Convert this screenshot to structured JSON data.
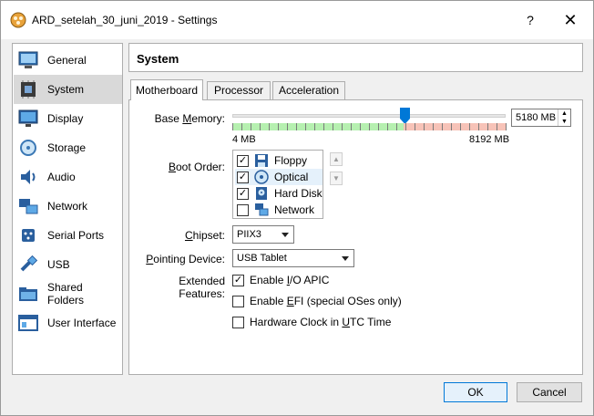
{
  "window": {
    "title": "ARD_setelah_30_juni_2019 - Settings",
    "help": "?",
    "close": "✕"
  },
  "sidebar": {
    "items": [
      {
        "label": "General",
        "icon": "general-icon"
      },
      {
        "label": "System",
        "icon": "system-icon",
        "active": true
      },
      {
        "label": "Display",
        "icon": "display-icon"
      },
      {
        "label": "Storage",
        "icon": "storage-icon"
      },
      {
        "label": "Audio",
        "icon": "audio-icon"
      },
      {
        "label": "Network",
        "icon": "network-icon"
      },
      {
        "label": "Serial Ports",
        "icon": "serial-ports-icon"
      },
      {
        "label": "USB",
        "icon": "usb-icon"
      },
      {
        "label": "Shared Folders",
        "icon": "shared-folders-icon"
      },
      {
        "label": "User Interface",
        "icon": "user-interface-icon"
      }
    ]
  },
  "page": {
    "title": "System"
  },
  "tabs": [
    {
      "label": "Motherboard",
      "active": true
    },
    {
      "label": "Processor"
    },
    {
      "label": "Acceleration"
    }
  ],
  "motherboard": {
    "base_memory": {
      "label_pre": "Base ",
      "label_u": "M",
      "label_post": "emory:",
      "min": "4 MB",
      "max": "8192 MB",
      "value": "5180 MB",
      "fraction": 0.632
    },
    "boot_order": {
      "label_pre": "",
      "label_u": "B",
      "label_post": "oot Order:",
      "items": [
        {
          "label": "Floppy",
          "checked": true,
          "icon": "floppy-icon"
        },
        {
          "label": "Optical",
          "checked": true,
          "icon": "optical-icon",
          "selected": true
        },
        {
          "label": "Hard Disk",
          "checked": true,
          "icon": "hard-disk-icon"
        },
        {
          "label": "Network",
          "checked": false,
          "icon": "network-icon"
        }
      ]
    },
    "chipset": {
      "label_pre": "",
      "label_u": "C",
      "label_post": "hipset:",
      "value": "PIIX3"
    },
    "pointing_device": {
      "label_pre": "",
      "label_u": "P",
      "label_post": "ointing Device:",
      "value": "USB Tablet"
    },
    "extended_features": {
      "label": "Extended Features:",
      "items": [
        {
          "pre": "Enable ",
          "u": "I",
          "post": "/O APIC",
          "checked": true
        },
        {
          "pre": "Enable ",
          "u": "E",
          "post": "FI (special OSes only)",
          "checked": false
        },
        {
          "pre": "Hardware Clock in ",
          "u": "U",
          "post": "TC Time",
          "checked": false
        }
      ]
    }
  },
  "buttons": {
    "ok": "OK",
    "cancel": "Cancel"
  },
  "colors": {
    "accent": "#0078d7",
    "slider_green": "#b6f0b0",
    "slider_red": "#f7c3b8"
  }
}
